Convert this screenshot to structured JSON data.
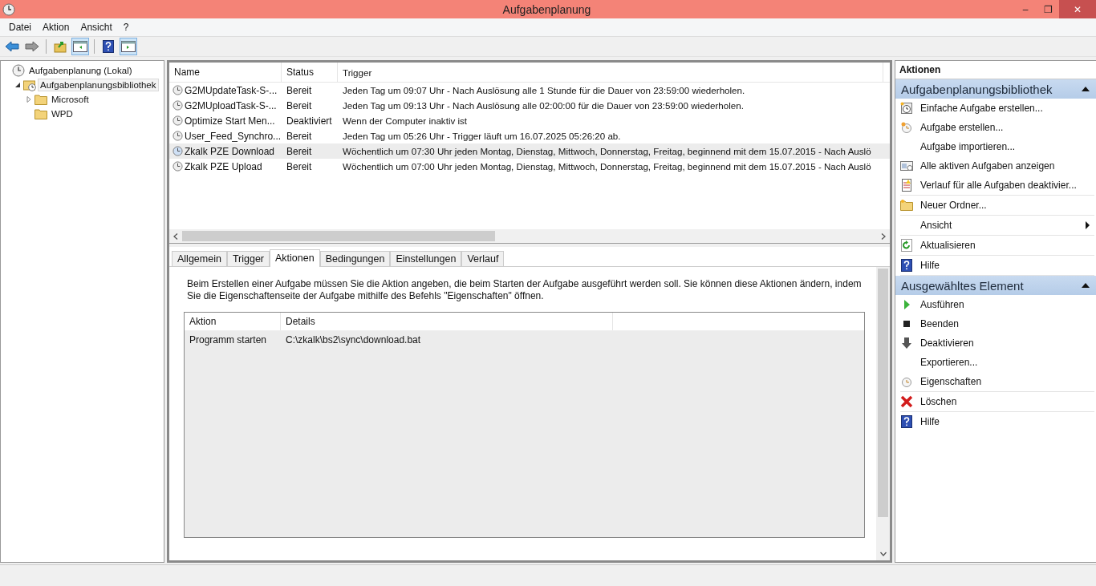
{
  "window": {
    "title": "Aufgabenplanung",
    "controls": [
      "–",
      "❐",
      "✕"
    ]
  },
  "menu": [
    "Datei",
    "Aktion",
    "Ansicht",
    "?"
  ],
  "toolbar": [
    [
      {
        "kind": "back",
        "selected": false
      },
      {
        "kind": "forward",
        "selected": false
      }
    ],
    [
      {
        "kind": "up",
        "selected": false
      },
      {
        "kind": "pane-left",
        "selected": true
      }
    ],
    [
      {
        "kind": "help",
        "selected": false
      },
      {
        "kind": "pane-right",
        "selected": true
      }
    ]
  ],
  "tree": [
    {
      "label": "Aufgabenplanung (Lokal)",
      "kind": "clock",
      "selected": false,
      "children": [
        {
          "label": "Aufgabenplanungsbibliothek",
          "kind": "clock-folder",
          "selected": true,
          "expanded": true,
          "children": [
            {
              "label": "Microsoft",
              "kind": "folder",
              "selected": false,
              "expanded": false
            },
            {
              "label": "WPD",
              "kind": "folder",
              "selected": false
            }
          ]
        }
      ]
    }
  ],
  "tasks": {
    "columns": [
      "Name",
      "Status",
      "Trigger"
    ],
    "rows": [
      {
        "name": "G2MUpdateTask-S-...",
        "status": "Bereit",
        "trigger": "Jeden Tag um 09:07 Uhr - Nach Auslösung alle 1 Stunde für die Dauer von 23:59:00 wiederholen.",
        "selected": false
      },
      {
        "name": "G2MUploadTask-S-...",
        "status": "Bereit",
        "trigger": "Jeden Tag um 09:13 Uhr - Nach Auslösung alle 02:00:00 für die Dauer von 23:59:00 wiederholen.",
        "selected": false
      },
      {
        "name": "Optimize Start Men...",
        "status": "Deaktiviert",
        "trigger": "Wenn der Computer inaktiv ist",
        "selected": false
      },
      {
        "name": "User_Feed_Synchro...",
        "status": "Bereit",
        "trigger": "Jeden Tag um 05:26 Uhr - Trigger läuft um 16.07.2025 05:26:20 ab.",
        "selected": false
      },
      {
        "name": "Zkalk PZE Download",
        "status": "Bereit",
        "trigger": "Wöchentlich um 07:30 Uhr jeden Montag, Dienstag, Mittwoch, Donnerstag, Freitag, beginnend mit dem 15.07.2015 - Nach Auslö",
        "selected": true
      },
      {
        "name": "Zkalk PZE Upload",
        "status": "Bereit",
        "trigger": "Wöchentlich um 07:00 Uhr jeden Montag, Dienstag, Mittwoch, Donnerstag, Freitag, beginnend mit dem 15.07.2015 - Nach Auslö",
        "selected": false
      }
    ]
  },
  "detail_tabs": [
    {
      "label": "Allgemein",
      "selected": false
    },
    {
      "label": "Trigger",
      "selected": false
    },
    {
      "label": "Aktionen",
      "selected": true
    },
    {
      "label": "Bedingungen",
      "selected": false
    },
    {
      "label": "Einstellungen",
      "selected": false
    },
    {
      "label": "Verlauf",
      "selected": false
    }
  ],
  "detail": {
    "description": "Beim Erstellen einer Aufgabe müssen Sie die Aktion angeben, die beim Starten der Aufgabe ausgeführt werden soll. Sie können diese Aktionen ändern, indem Sie die Eigenschaftenseite der Aufgabe mithilfe des Befehls \"Eigenschaften\" öffnen.",
    "columns": [
      "Aktion",
      "Details"
    ],
    "rows": [
      {
        "action": "Programm starten",
        "details": "C:\\zkalk\\bs2\\sync\\download.bat"
      }
    ]
  },
  "actions": {
    "title": "Aktionen",
    "sections": [
      {
        "title": "Aufgabenplanungsbibliothek",
        "expanded": true,
        "groups": [
          [
            {
              "label": "Einfache Aufgabe erstellen...",
              "kind": "wizard",
              "submenu": false
            },
            {
              "label": "Aufgabe erstellen...",
              "kind": "task",
              "submenu": false
            },
            {
              "label": "Aufgabe importieren...",
              "kind": "none",
              "submenu": false
            },
            {
              "label": "Alle aktiven Aufgaben anzeigen",
              "kind": "list",
              "submenu": false
            },
            {
              "label": "Verlauf für alle Aufgaben deaktivier...",
              "kind": "log",
              "submenu": false
            }
          ],
          [
            {
              "label": "Neuer Ordner...",
              "kind": "folder",
              "submenu": false
            }
          ],
          [
            {
              "label": "Ansicht",
              "kind": "none",
              "submenu": true
            }
          ],
          [
            {
              "label": "Aktualisieren",
              "kind": "refresh",
              "submenu": false
            }
          ],
          [
            {
              "label": "Hilfe",
              "kind": "help",
              "submenu": false
            }
          ]
        ]
      },
      {
        "title": "Ausgewähltes Element",
        "expanded": true,
        "groups": [
          [
            {
              "label": "Ausführen",
              "kind": "run",
              "submenu": false
            },
            {
              "label": "Beenden",
              "kind": "stop",
              "submenu": false
            },
            {
              "label": "Deaktivieren",
              "kind": "disable",
              "submenu": false
            },
            {
              "label": "Exportieren...",
              "kind": "none",
              "submenu": false
            },
            {
              "label": "Eigenschaften",
              "kind": "clock",
              "submenu": false
            }
          ],
          [
            {
              "label": "Löschen",
              "kind": "delete",
              "submenu": false
            }
          ],
          [
            {
              "label": "Hilfe",
              "kind": "help",
              "submenu": false
            }
          ]
        ]
      }
    ]
  }
}
